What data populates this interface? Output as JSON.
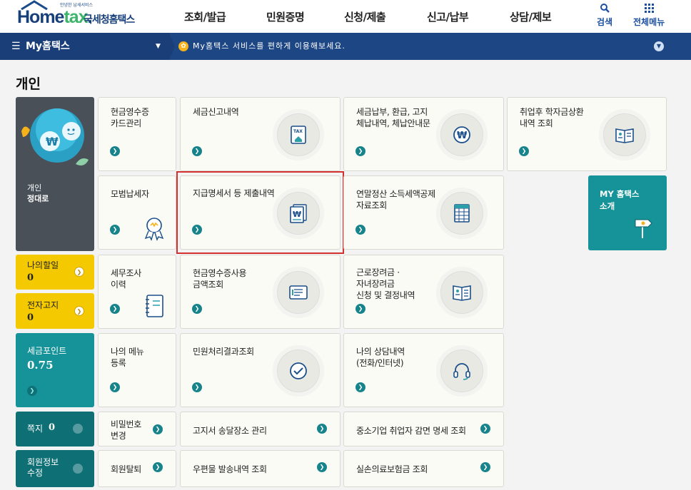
{
  "header": {
    "logo_small": "안녕한 납세서비스",
    "logo_brand": "Home",
    "logo_tax": "tax",
    "logo_dot": ".",
    "logo_ko": "국세청홈택스",
    "nav": [
      "조회/발급",
      "민원증명",
      "신청/제출",
      "신고/납부",
      "상담/제보"
    ],
    "search_label": "검색",
    "allmenu_label": "전체메뉴"
  },
  "subbar": {
    "title": "My홈택스",
    "message": "My홈택스 서비스를 편하게 이용해보세요."
  },
  "page": {
    "title": "개인"
  },
  "profile": {
    "label": "개인",
    "name": "정대로"
  },
  "left_tiles": {
    "todo_label": "나의할일",
    "todo_count": "0",
    "notice_label": "전자고지",
    "notice_count": "0",
    "points_label": "세금포인트",
    "points_value": "0.75",
    "note_label": "쪽지",
    "note_count": "0",
    "member_label": "회원정보\n수정"
  },
  "cards": {
    "cash_receipt": "현금영수증\n카드관리",
    "tax_return": "세금신고내역",
    "tax_pay": "세금납부, 환급, 고지\n체납내역, 체납안내문",
    "student_loan": "취업후 학자금상환\n내역 조회",
    "model_taxpayer": "모범납세자",
    "payment_stmt": "지급명세서 등 제출내역",
    "year_end": "연말정산 소득세액공제\n자료조회",
    "my_hometax": "MY 홈택스\n소개",
    "audit": "세무조사\n이력",
    "cash_usage": "현금영수증사용\n금액조회",
    "earned_credit": "근로장려금 ·\n자녀장려금\n신청 및 결정내역",
    "my_menu": "나의 메뉴\n등록",
    "civil_result": "민원처리결과조회",
    "consult": "나의 상담내역\n(전화/인터넷)",
    "password": "비밀번호\n변경",
    "notice_place": "고지서 송달장소 관리",
    "sme_reduction": "중소기업 취업자 감면 명세 조회",
    "withdraw": "회원탈퇴",
    "mail_history": "우편물 발송내역 조회",
    "medical_ins": "실손의료보험금 조회"
  },
  "icons": {
    "tax_label": "TAX",
    "won": "₩"
  }
}
